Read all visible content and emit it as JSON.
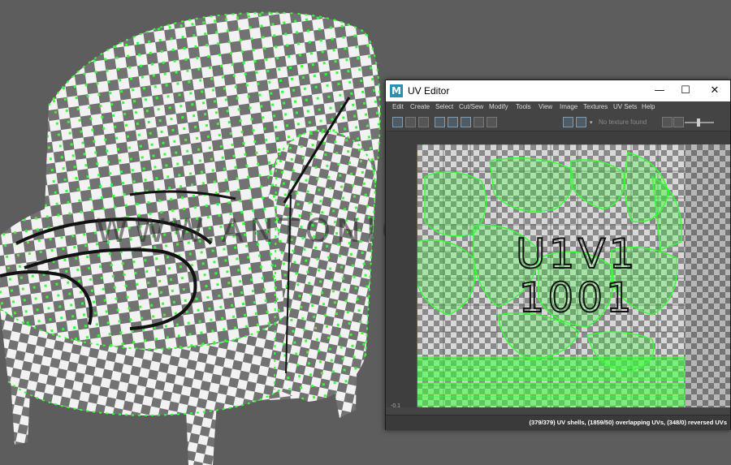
{
  "watermark": "WWW.ANTONIOBOSI.COM",
  "uv_editor": {
    "title": "UV Editor",
    "logo_letter": "M",
    "window_controls": {
      "minimize": "—",
      "maximize": "☐",
      "close": "✕"
    },
    "menu": [
      "Edit",
      "Create",
      "Select",
      "Cut/Sew",
      "Modify",
      "Tools",
      "View",
      "Image",
      "Textures",
      "UV Sets",
      "Help"
    ],
    "toolbar": {
      "texture_status": "No texture found",
      "icons": [
        "grid-icon",
        "shaded-uv-icon",
        "distortion-icon",
        "texture-borders-icon",
        "checker-icon",
        "snapshot-icon",
        "image-display-icon",
        "checker-toggle-icon",
        "exposure-icon"
      ]
    },
    "tile": {
      "line1": "U1V1",
      "line2": "1001"
    },
    "coord_label": "-0.1",
    "status": "(379/379) UV shells, (1859/50) overlapping UVs, (348/0) reversed UVs"
  },
  "colors": {
    "uv_green": "#33ff33",
    "background": "#5d5d5d",
    "checker_dark": "#727272",
    "checker_light": "#f2f2f2"
  }
}
